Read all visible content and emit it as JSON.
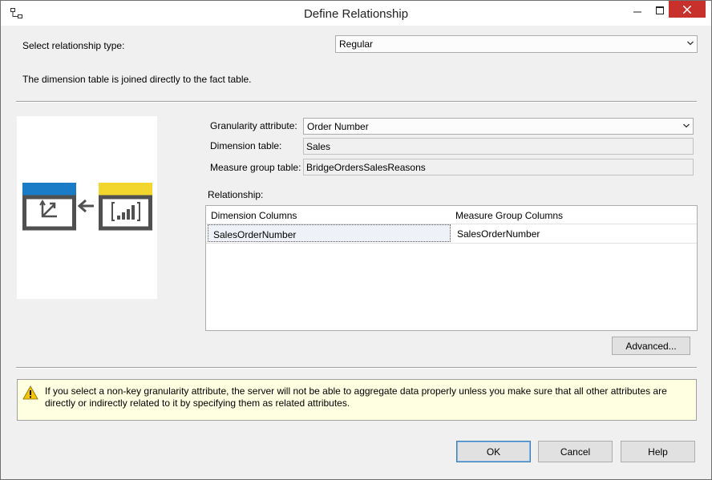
{
  "window": {
    "title": "Define Relationship"
  },
  "relationship_type": {
    "label": "Select relationship type:",
    "value": "Regular",
    "description": "The dimension table is joined directly to the fact table."
  },
  "fields": {
    "granularity_label": "Granularity attribute:",
    "granularity_value": "Order Number",
    "dimension_label": "Dimension table:",
    "dimension_value": "Sales",
    "measure_group_label": "Measure group table:",
    "measure_group_value": "BridgeOrdersSalesReasons"
  },
  "relationship": {
    "label": "Relationship:",
    "columns": [
      "Dimension Columns",
      "Measure Group Columns"
    ],
    "rows": [
      [
        "SalesOrderNumber",
        "SalesOrderNumber"
      ]
    ]
  },
  "buttons": {
    "advanced": "Advanced...",
    "ok": "OK",
    "cancel": "Cancel",
    "help": "Help"
  },
  "warning": {
    "icon": "warning-triangle-icon",
    "text": "If you select a non-key granularity attribute, the server will not be able to aggregate data properly unless you make sure that all other attributes are directly or indirectly related to it by specifying them as related attributes."
  },
  "colors": {
    "dimension_accent": "#1a7bc6",
    "fact_accent": "#f2d62e",
    "close_button": "#c7302b",
    "warning_background": "#ffffe1"
  }
}
